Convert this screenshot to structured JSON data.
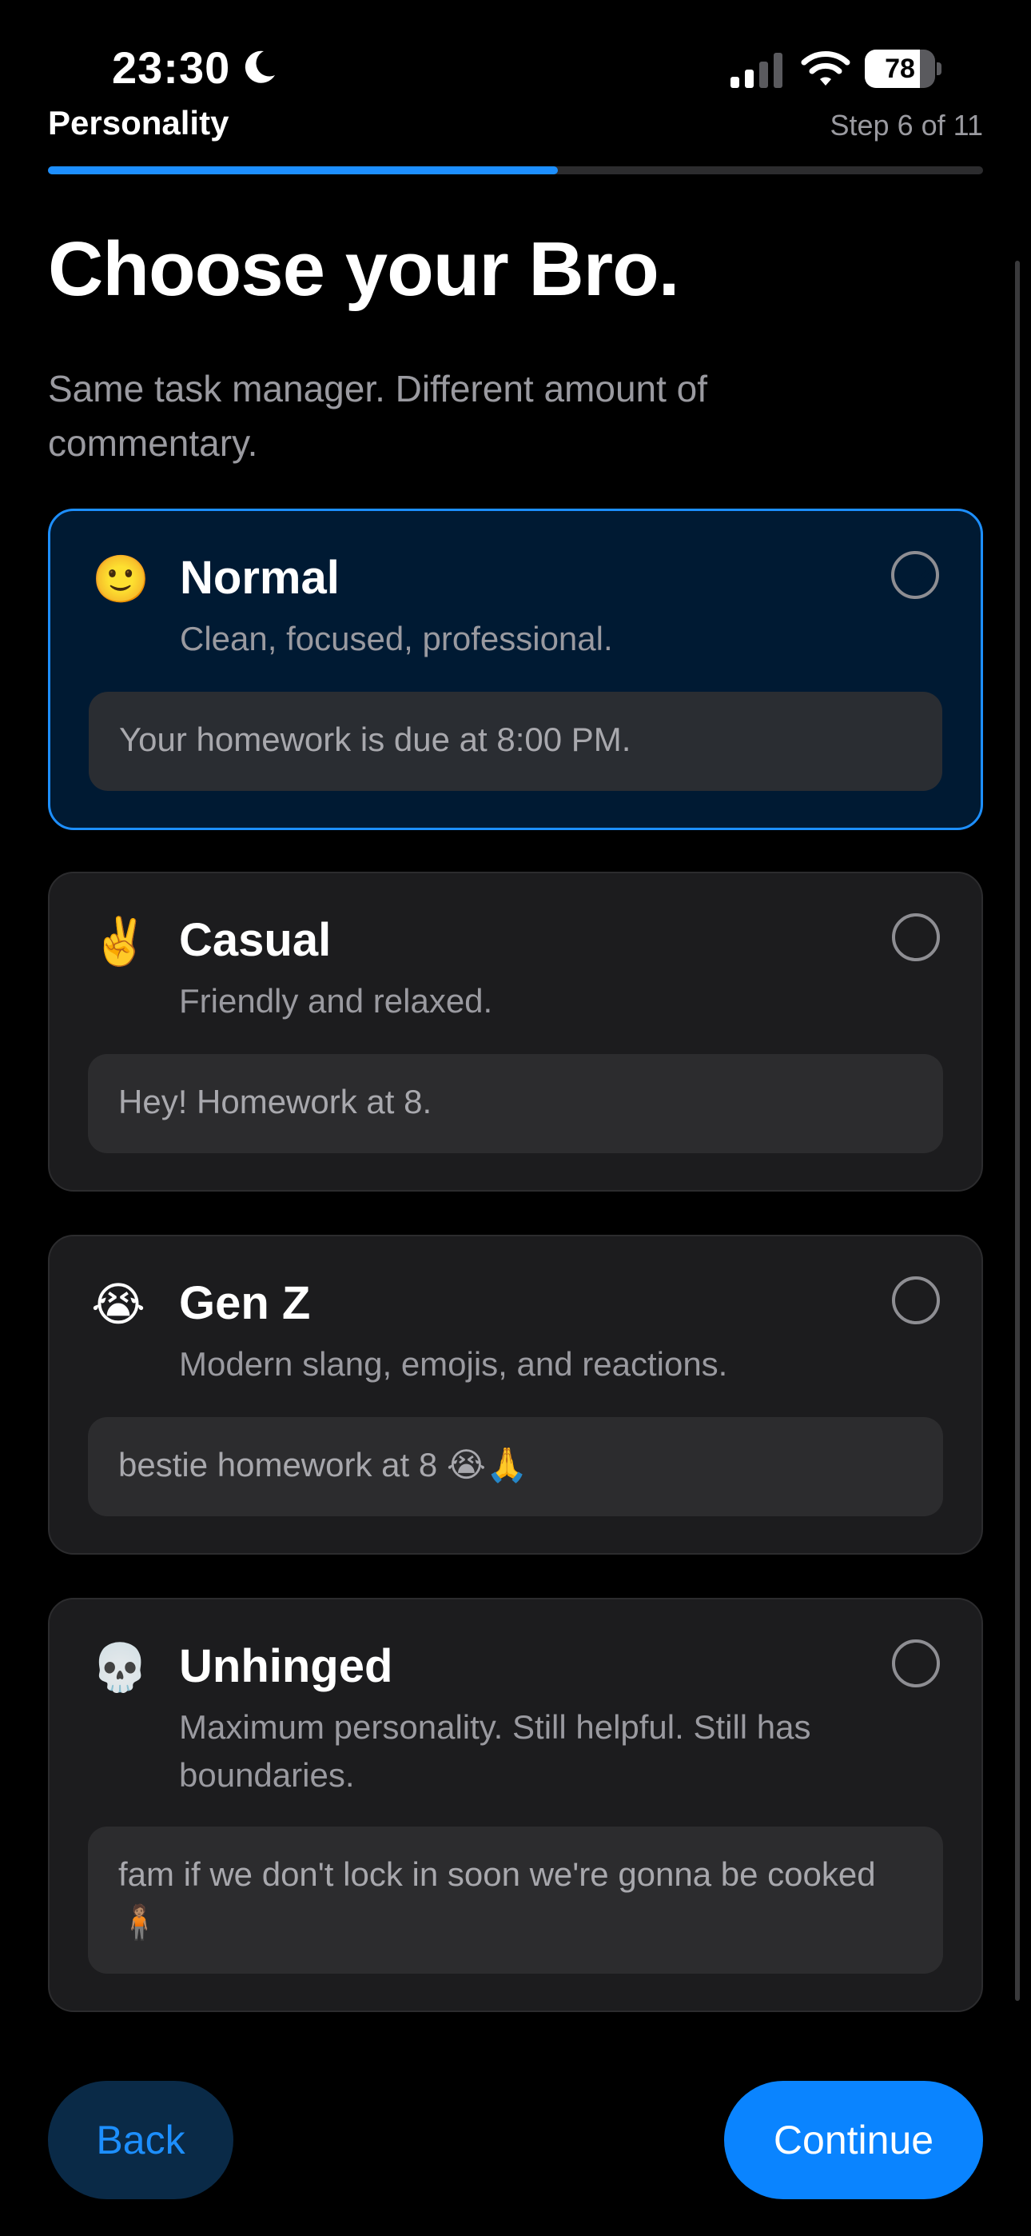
{
  "status_bar": {
    "time": "23:30",
    "battery": "78",
    "battery_level": 0.78,
    "icons": [
      "moon-icon",
      "signal-icon",
      "wifi-icon",
      "battery-icon"
    ]
  },
  "header": {
    "title": "Personality",
    "step": "Step 6 of 11",
    "progress": 0.545
  },
  "page": {
    "title": "Choose your Bro.",
    "subtitle": "Same task manager. Different amount of commentary."
  },
  "options": [
    {
      "emoji": "🙂",
      "title": "Normal",
      "description": "Clean, focused, professional.",
      "example": "Your homework is due at 8:00 PM.",
      "selected": true
    },
    {
      "emoji": "✌️",
      "title": "Casual",
      "description": "Friendly and relaxed.",
      "example": "Hey! Homework at 8.",
      "selected": false
    },
    {
      "emoji": "😭",
      "title": "Gen Z",
      "description": "Modern slang, emojis, and reactions.",
      "example": "bestie homework at 8 😭🙏",
      "selected": false
    },
    {
      "emoji": "💀",
      "title": "Unhinged",
      "description": "Maximum personality. Still helpful. Still has boundaries.",
      "example": "fam if we don't lock in soon we're gonna be cooked 🧍🏽",
      "selected": false
    }
  ],
  "actions": {
    "back": "Back",
    "continue": "Continue"
  },
  "colors": {
    "accent": "#1d8fff",
    "background": "#000000",
    "card": "#1c1c1e",
    "selected_card": "#001a33"
  }
}
